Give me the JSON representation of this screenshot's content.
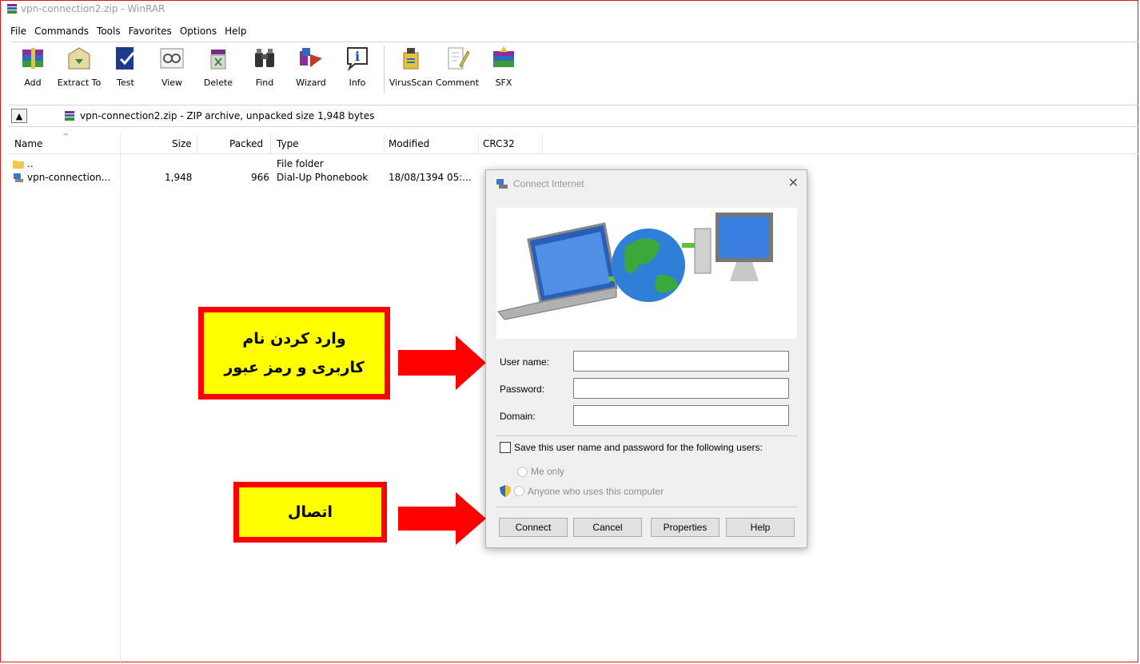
{
  "window": {
    "title": "vpn-connection2.zip - WinRAR"
  },
  "menu": [
    "File",
    "Commands",
    "Tools",
    "Favorites",
    "Options",
    "Help"
  ],
  "toolbar": [
    {
      "label": "Add",
      "icon": "add-archive-icon"
    },
    {
      "label": "Extract To",
      "icon": "extract-to-icon"
    },
    {
      "label": "Test",
      "icon": "test-icon"
    },
    {
      "label": "View",
      "icon": "view-icon"
    },
    {
      "label": "Delete",
      "icon": "delete-icon"
    },
    {
      "label": "Find",
      "icon": "find-binoculars-icon"
    },
    {
      "label": "Wizard",
      "icon": "wizard-icon"
    },
    {
      "label": "Info",
      "icon": "info-icon"
    },
    {
      "label": "VirusScan",
      "icon": "virusscan-icon"
    },
    {
      "label": "Comment",
      "icon": "comment-icon"
    },
    {
      "label": "SFX",
      "icon": "sfx-icon"
    }
  ],
  "address": {
    "text": "vpn-connection2.zip - ZIP archive, unpacked size 1,948 bytes"
  },
  "columns": {
    "name": "Name",
    "size": "Size",
    "packed": "Packed",
    "type": "Type",
    "modified": "Modified",
    "crc": "CRC32"
  },
  "files": [
    {
      "name": "..",
      "size": "",
      "packed": "",
      "type": "File folder",
      "modified": ""
    },
    {
      "name": "vpn-connection...",
      "size": "1,948",
      "packed": "966",
      "type": "Dial-Up Phonebook",
      "modified": "18/08/1394 05:..."
    }
  ],
  "callouts": {
    "credentials_line1": "وارد کردن نام",
    "credentials_line2": "کاربری و رمز عبور",
    "connect": "اتصال"
  },
  "dialog": {
    "title": "Connect Internet",
    "username_label": "User name:",
    "password_label": "Password:",
    "domain_label": "Domain:",
    "username_value": "",
    "password_value": "",
    "domain_value": "",
    "save_label": "Save this user name and password for the following users:",
    "me_only": "Me only",
    "anyone": "Anyone who uses this computer",
    "buttons": {
      "connect": "Connect",
      "cancel": "Cancel",
      "properties": "Properties",
      "help": "Help"
    }
  },
  "colors": {
    "accent_red": "#ff0000",
    "callout_yellow": "#ffff00"
  }
}
